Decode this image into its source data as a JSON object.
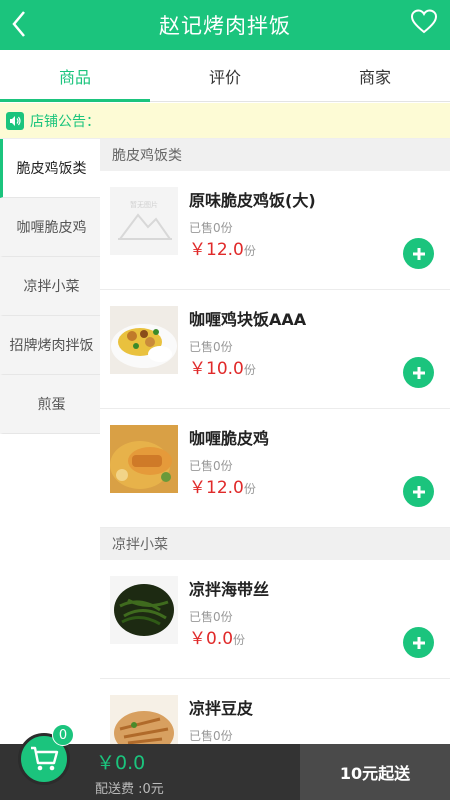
{
  "header": {
    "title": "赵记烤肉拌饭",
    "back_icon": "chevron-left-icon",
    "fav_icon": "heart-icon"
  },
  "tabs": [
    {
      "label": "商品",
      "active": true
    },
    {
      "label": "评价",
      "active": false
    },
    {
      "label": "商家",
      "active": false
    }
  ],
  "notice": {
    "label": "店铺公告："
  },
  "categories": [
    {
      "label": "脆皮鸡饭类",
      "active": true
    },
    {
      "label": "咖喱脆皮鸡",
      "active": false
    },
    {
      "label": "凉拌小菜",
      "active": false
    },
    {
      "label": "招牌烤肉拌饭",
      "active": false
    },
    {
      "label": "煎蛋",
      "active": false
    }
  ],
  "sections": [
    {
      "title": "脆皮鸡饭类",
      "items": [
        {
          "name": "原味脆皮鸡饭(大)",
          "sold": "已售0份",
          "price": "￥12.0",
          "unit": "份",
          "image": "placeholder",
          "placeholder_text": "暂无图片"
        },
        {
          "name": "咖喱鸡块饭AAA",
          "sold": "已售0份",
          "price": "￥10.0",
          "unit": "份",
          "image": "curry-chicken"
        },
        {
          "name": "咖喱脆皮鸡",
          "sold": "已售0份",
          "price": "￥12.0",
          "unit": "份",
          "image": "curry-cutlet"
        }
      ]
    },
    {
      "title": "凉拌小菜",
      "items": [
        {
          "name": "凉拌海带丝",
          "sold": "已售0份",
          "price": "￥0.0",
          "unit": "份",
          "image": "seaweed"
        },
        {
          "name": "凉拌豆皮",
          "sold": "已售0份",
          "price": "",
          "unit": "",
          "image": "tofu-skin"
        }
      ]
    }
  ],
  "cart": {
    "count": "0",
    "total": "￥0.0",
    "delivery_fee": "配送费 :0元",
    "min_order": "10元起送"
  },
  "colors": {
    "accent": "#1bc47d",
    "price": "#e02a2a",
    "bar": "#333333"
  }
}
